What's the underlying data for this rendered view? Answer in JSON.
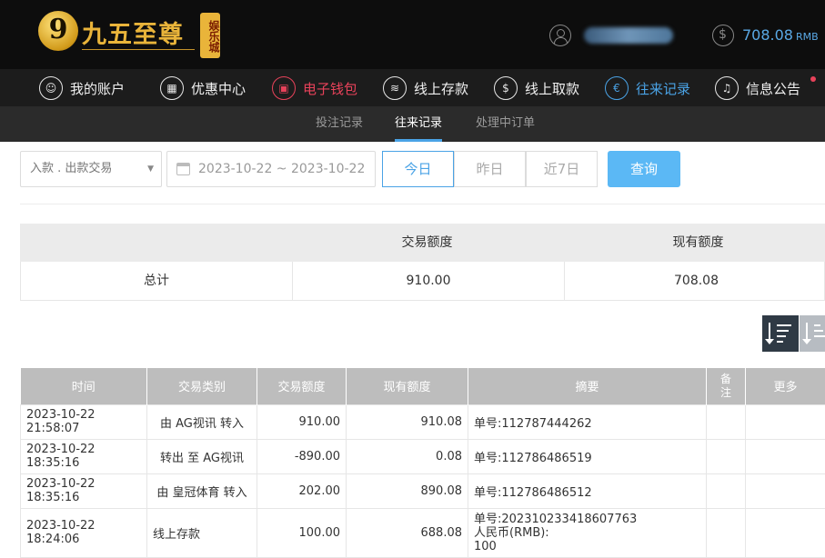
{
  "header": {
    "logo_digit": "9",
    "logo_text": "九五至尊",
    "logo_badge": "娱乐城",
    "balance_value": "708.08",
    "balance_currency": "RMB",
    "user_icon": "user-icon",
    "coin_icon": "dollar-coin-icon"
  },
  "nav": {
    "items": [
      {
        "label": "我的账户",
        "icon": "user-icon"
      },
      {
        "label": "优惠中心",
        "icon": "gift-icon"
      },
      {
        "label": "电子钱包",
        "icon": "wallet-icon"
      },
      {
        "label": "线上存款",
        "icon": "deposit-icon"
      },
      {
        "label": "线上取款",
        "icon": "withdraw-icon"
      },
      {
        "label": "往来记录",
        "icon": "records-icon"
      },
      {
        "label": "信息公告",
        "icon": "bell-icon"
      }
    ],
    "active_red": "电子钱包",
    "active_blue": "往来记录"
  },
  "subnav": {
    "tabs": [
      "投注记录",
      "往来记录",
      "处理中订单"
    ],
    "active": "往来记录"
  },
  "filters": {
    "type_select": "入款 . 出款交易",
    "date_range": "2023-10-22 ~ 2023-10-22",
    "quick": [
      "今日",
      "昨日",
      "近7日"
    ],
    "quick_active": "今日",
    "query_label": "查询"
  },
  "summary": {
    "headers": [
      "",
      "交易额度",
      "现有额度"
    ],
    "row": [
      "总计",
      "910.00",
      "708.08"
    ]
  },
  "records": {
    "columns": [
      "时间",
      "交易类别",
      "交易额度",
      "现有额度",
      "摘要",
      "备注",
      "更多"
    ],
    "rows": [
      {
        "time": "2023-10-22 21:58:07",
        "type": "由 AG视讯 转入",
        "amount": "910.00",
        "balance": "910.08",
        "summary": "单号:112787444262"
      },
      {
        "time": "2023-10-22 18:35:16",
        "type": "转出 至 AG视讯",
        "amount": "-890.00",
        "balance": "0.08",
        "summary": "单号:112786486519"
      },
      {
        "time": "2023-10-22 18:35:16",
        "type": "由 皇冠体育 转入",
        "amount": "202.00",
        "balance": "890.08",
        "summary": "单号:112786486512"
      },
      {
        "time": "2023-10-22 18:24:06",
        "type": "线上存款",
        "amount": "100.00",
        "balance": "688.08",
        "summary_lines": [
          "单号:202310233418607763",
          "人民币(RMB):",
          "100"
        ]
      }
    ]
  }
}
